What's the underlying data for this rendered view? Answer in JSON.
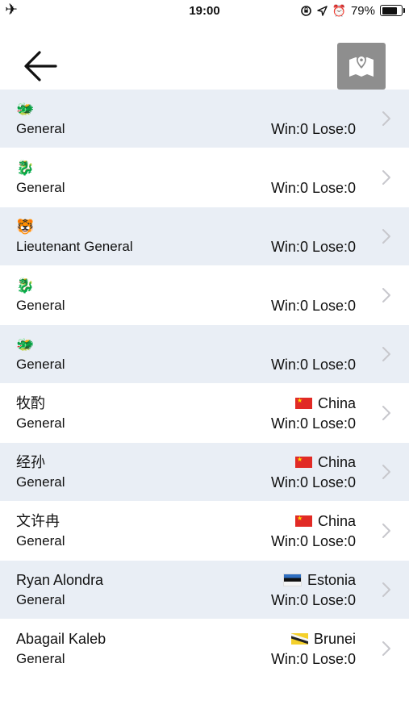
{
  "status_bar": {
    "airplane_icon": "airplane-icon",
    "time": "19:00",
    "battery": "79%",
    "battery_level": 0.79
  },
  "header": {
    "back_icon": "arrow-left-icon",
    "map_icon": "map-pin-icon"
  },
  "rows": [
    {
      "avatar": "🐲",
      "name": "",
      "rank": "General",
      "country": "",
      "flag": "",
      "record": "Win:0 Lose:0"
    },
    {
      "avatar": "🐉",
      "name": "",
      "rank": "General",
      "country": "",
      "flag": "",
      "record": "Win:0 Lose:0"
    },
    {
      "avatar": "🐯",
      "name": "",
      "rank": "Lieutenant General",
      "country": "",
      "flag": "",
      "record": "Win:0 Lose:0"
    },
    {
      "avatar": "🐉",
      "name": "",
      "rank": "General",
      "country": "",
      "flag": "",
      "record": "Win:0 Lose:0"
    },
    {
      "avatar": "🐲",
      "name": "",
      "rank": "General",
      "country": "",
      "flag": "",
      "record": "Win:0 Lose:0"
    },
    {
      "avatar": "",
      "name": "牧酌",
      "rank": "General",
      "country": "China",
      "flag": "china",
      "record": "Win:0 Lose:0"
    },
    {
      "avatar": "",
      "name": "经孙",
      "rank": "General",
      "country": "China",
      "flag": "china",
      "record": "Win:0 Lose:0"
    },
    {
      "avatar": "",
      "name": "文许冉",
      "rank": "General",
      "country": "China",
      "flag": "china",
      "record": "Win:0 Lose:0"
    },
    {
      "avatar": "",
      "name": "Ryan Alondra",
      "rank": "General",
      "country": "Estonia",
      "flag": "estonia",
      "record": "Win:0 Lose:0"
    },
    {
      "avatar": "",
      "name": "Abagail Kaleb",
      "rank": "General",
      "country": "Brunei",
      "flag": "brunei",
      "record": "Win:0 Lose:0"
    }
  ],
  "colors": {
    "row_shaded": "#e9eef5",
    "row_plain": "#ffffff",
    "map_button_bg": "#8e8e8e",
    "chevron": "#c7c7cc"
  }
}
